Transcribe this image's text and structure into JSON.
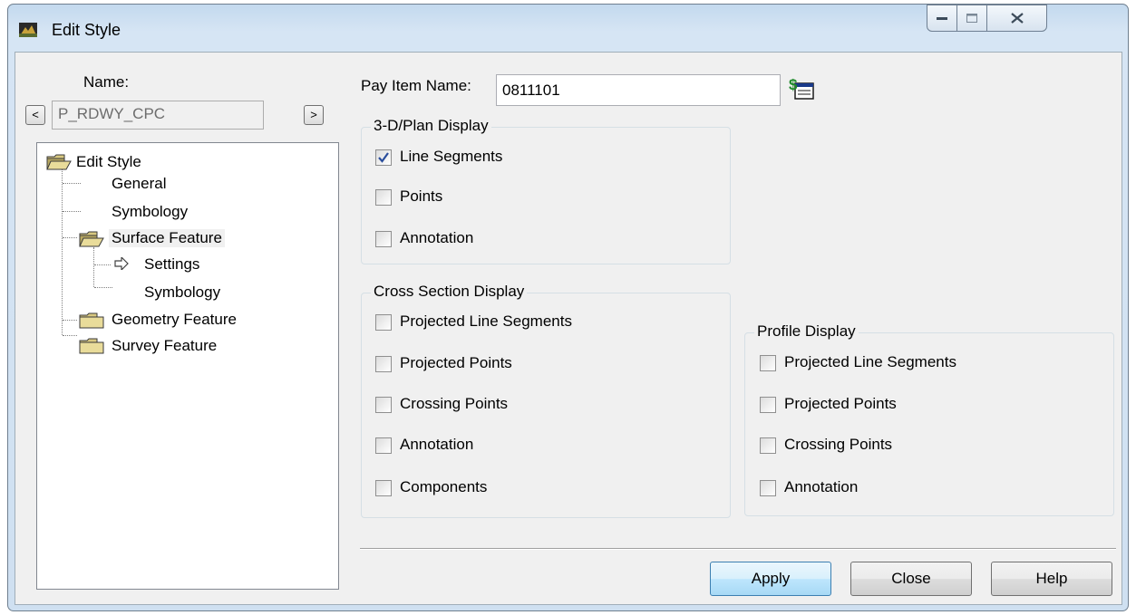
{
  "window": {
    "title": "Edit Style"
  },
  "left": {
    "name_label": "Name:",
    "name_value": "P_RDWY_CPC",
    "prev_label": "<",
    "next_label": ">",
    "tree": {
      "root": "Edit Style",
      "general": "General",
      "symbology": "Symbology",
      "surface_feature": "Surface Feature",
      "settings": "Settings",
      "surface_symbology": "Symbology",
      "geometry_feature": "Geometry Feature",
      "survey_feature": "Survey Feature"
    }
  },
  "pay_item": {
    "label": "Pay Item Name:",
    "value": "0811101"
  },
  "plan_display": {
    "title": "3-D/Plan Display",
    "items": [
      {
        "label": "Line Segments",
        "checked": true
      },
      {
        "label": "Points",
        "checked": false
      },
      {
        "label": "Annotation",
        "checked": false
      }
    ]
  },
  "cross_section_display": {
    "title": "Cross Section Display",
    "items": [
      {
        "label": "Projected Line Segments",
        "checked": false
      },
      {
        "label": "Projected Points",
        "checked": false
      },
      {
        "label": "Crossing Points",
        "checked": false
      },
      {
        "label": "Annotation",
        "checked": false
      },
      {
        "label": "Components",
        "checked": false
      }
    ]
  },
  "profile_display": {
    "title": "Profile Display",
    "items": [
      {
        "label": "Projected Line Segments",
        "checked": false
      },
      {
        "label": "Projected Points",
        "checked": false
      },
      {
        "label": "Crossing Points",
        "checked": false
      },
      {
        "label": "Annotation",
        "checked": false
      }
    ]
  },
  "buttons": {
    "apply": "Apply",
    "close": "Close",
    "help": "Help"
  }
}
